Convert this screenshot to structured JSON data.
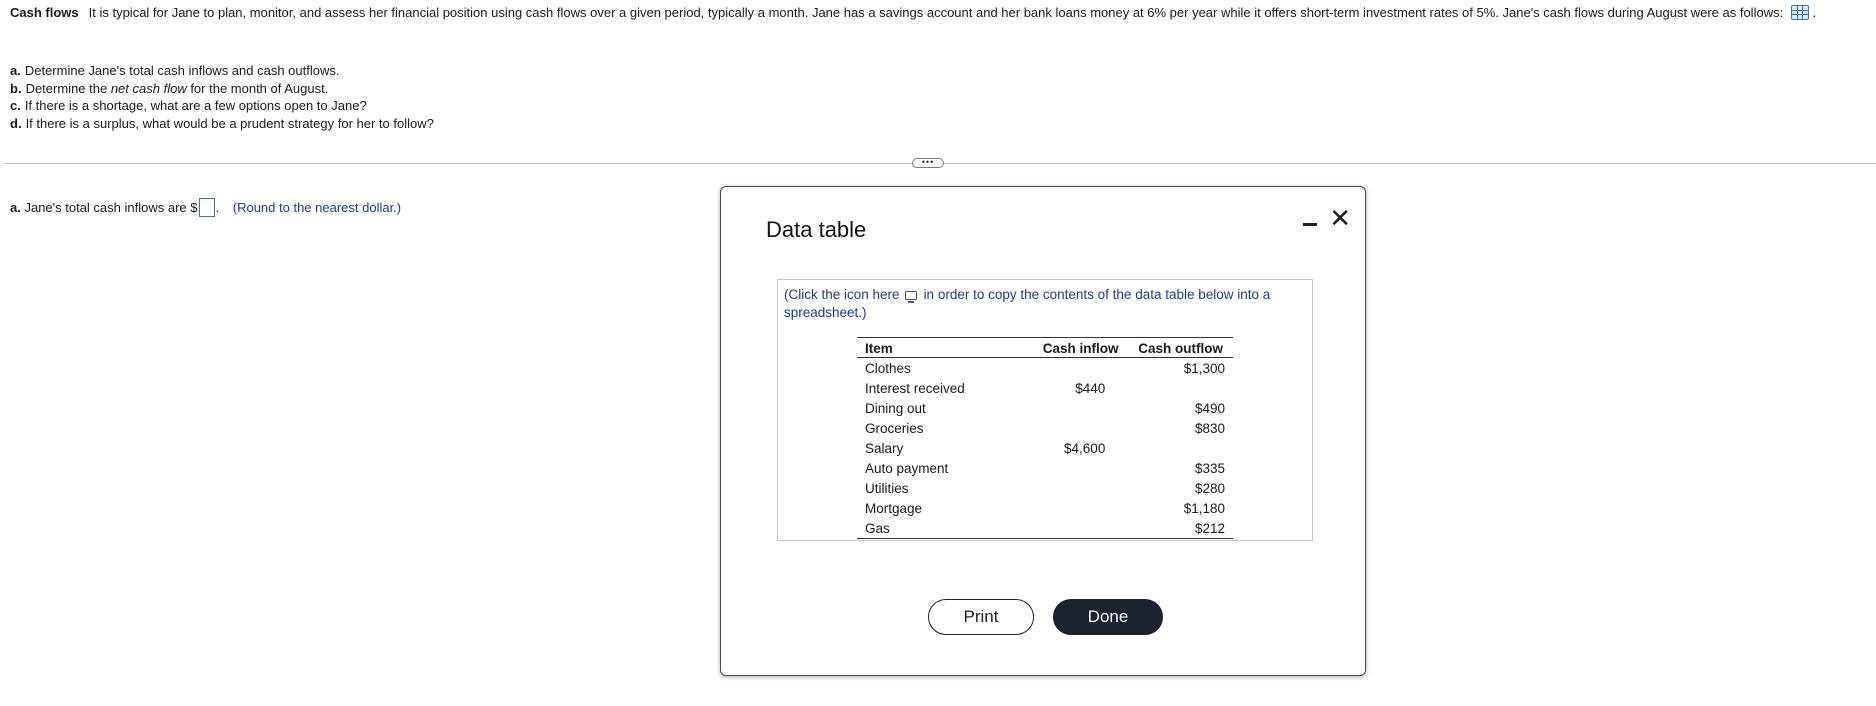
{
  "question": {
    "title": "Cash flows",
    "body": "It is typical for Jane to plan, monitor, and assess her financial position using cash flows over a given period, typically a month.  Jane has a savings account and her bank loans money at 6% per year while it offers short-term investment rates of 5%.  Jane's cash flows during August were as follows:"
  },
  "parts": [
    {
      "label": "a.",
      "pre": "Determine Jane's total cash inflows and cash outflows.",
      "em": "",
      "post": ""
    },
    {
      "label": "b.",
      "pre": "Determine the ",
      "em": "net cash flow",
      "post": " for the month of August."
    },
    {
      "label": "c.",
      "pre": "If there is a shortage, what are a few options open to Jane?",
      "em": "",
      "post": ""
    },
    {
      "label": "d.",
      "pre": "If there is a surplus, what would be a prudent strategy for her to follow?",
      "em": "",
      "post": ""
    }
  ],
  "expand_label": "•••",
  "answer": {
    "label": "a.",
    "text": "Jane's total cash inflows are $",
    "value": "",
    "suffix": ".",
    "hint": "(Round to the nearest dollar.)"
  },
  "dialog": {
    "title": "Data table",
    "copy_pre": "(Click the icon here",
    "copy_post": "in order to copy the contents of the data table below into a spreadsheet.)",
    "headers": [
      "Item",
      "Cash inflow",
      "Cash outflow"
    ],
    "rows": [
      {
        "item": "Clothes",
        "inflow": "",
        "outflow": "$1,300"
      },
      {
        "item": "Interest received",
        "inflow": "$440",
        "outflow": ""
      },
      {
        "item": "Dining out",
        "inflow": "",
        "outflow": "$490"
      },
      {
        "item": "Groceries",
        "inflow": "",
        "outflow": "$830"
      },
      {
        "item": "Salary",
        "inflow": "$4,600",
        "outflow": ""
      },
      {
        "item": "Auto payment",
        "inflow": "",
        "outflow": "$335"
      },
      {
        "item": "Utilities",
        "inflow": "",
        "outflow": "$280"
      },
      {
        "item": "Mortgage",
        "inflow": "",
        "outflow": "$1,180"
      },
      {
        "item": "Gas",
        "inflow": "",
        "outflow": "$212"
      }
    ],
    "print_label": "Print",
    "done_label": "Done"
  }
}
